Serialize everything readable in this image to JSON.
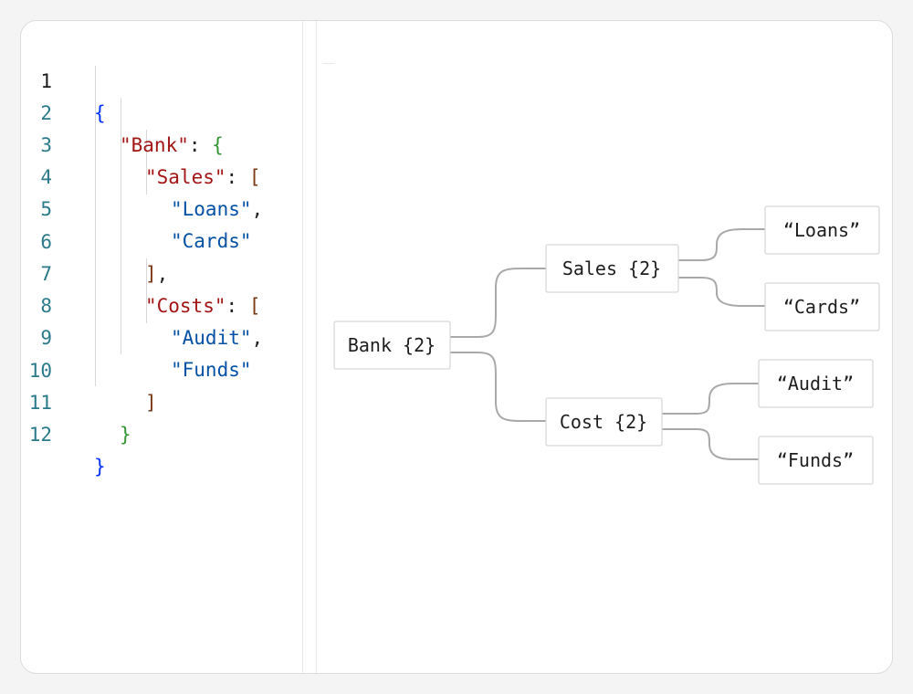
{
  "editor": {
    "line_numbers": [
      "1",
      "2",
      "3",
      "4",
      "5",
      "6",
      "7",
      "8",
      "9",
      "10",
      "11",
      "12"
    ],
    "tokens": {
      "l1_brace": "{",
      "l2_key": "\"Bank\"",
      "l2_colon": ": ",
      "l2_brace": "{",
      "l3_key": "\"Sales\"",
      "l3_colon": ": ",
      "l3_bracket": "[",
      "l4_val": "\"Loans\"",
      "l4_comma": ",",
      "l5_val": "\"Cards\"",
      "l6_bracket": "]",
      "l6_comma": ",",
      "l7_key": "\"Costs\"",
      "l7_colon": ": ",
      "l7_bracket": "[",
      "l8_val": "\"Audit\"",
      "l8_comma": ",",
      "l9_val": "\"Funds\"",
      "l10_bracket": "]",
      "l11_brace": "}",
      "l12_brace": "}"
    }
  },
  "tree": {
    "root": "Bank {2}",
    "sales": "Sales {2}",
    "cost": "Cost {2}",
    "loans": "“Loans”",
    "cards": "“Cards”",
    "audit": "“Audit”",
    "funds": "“Funds”"
  }
}
